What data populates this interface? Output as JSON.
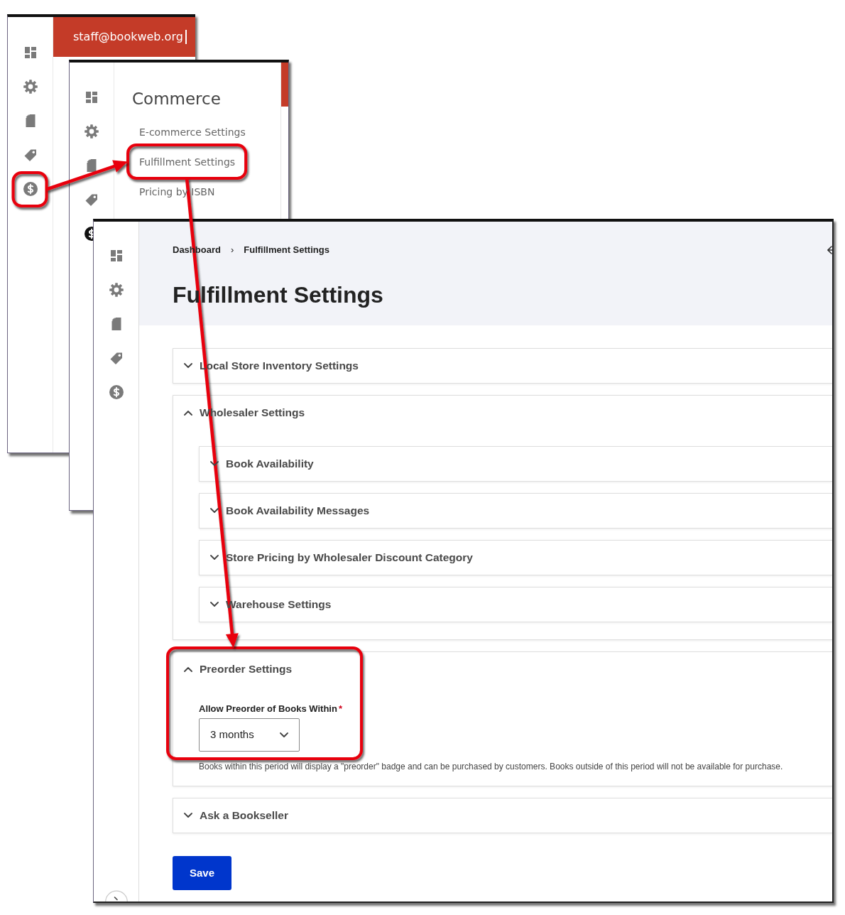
{
  "windows": [
    {
      "kind": "account",
      "account_email": "staff@bookweb.org",
      "sidebar_items": [
        {
          "selected": false,
          "highlighted": false
        },
        {
          "selected": false,
          "highlighted": false
        },
        {
          "selected": false,
          "highlighted": false
        },
        {
          "selected": false,
          "highlighted": false
        },
        {
          "selected": false,
          "highlighted": true
        }
      ]
    },
    {
      "kind": "menu",
      "sidebar_items": [
        {
          "selected": false
        },
        {
          "selected": false
        },
        {
          "selected": false
        },
        {
          "selected": false
        },
        {
          "selected": true
        }
      ],
      "menu": {
        "title": "Commerce",
        "items": [
          {
            "label": "E-commerce Settings",
            "highlighted": false
          },
          {
            "label": "Fulfillment Settings",
            "highlighted": true
          },
          {
            "label": "Pricing by ISBN",
            "highlighted": false
          }
        ]
      }
    },
    {
      "kind": "page",
      "sidebar_items": [
        {
          "selected": false
        },
        {
          "selected": false
        },
        {
          "selected": false
        },
        {
          "selected": false
        },
        {
          "selected": false
        }
      ],
      "breadcrumb": [
        "Dashboard",
        "Fulfillment Settings"
      ],
      "breadcrumb_separator": "›",
      "title": "Fulfillment Settings",
      "sections": [
        {
          "title": "Local Store Inventory Settings",
          "expanded": false,
          "highlighted": false
        },
        {
          "title": "Wholesaler Settings",
          "expanded": true,
          "highlighted": false,
          "children": [
            {
              "title": "Book Availability",
              "expanded": false
            },
            {
              "title": "Book Availability Messages",
              "expanded": false
            },
            {
              "title": "Store Pricing by Wholesaler Discount Category",
              "expanded": false
            },
            {
              "title": "Warehouse Settings",
              "expanded": false
            }
          ]
        },
        {
          "title": "Preorder Settings",
          "expanded": true,
          "highlighted": true,
          "fields": [
            {
              "label": "Allow Preorder of Books Within",
              "required_mark": "*",
              "value": "3 months",
              "help": "Books within this period will display a \"preorder\" badge and can be purchased by customers. Books outside of this period will not be available for purchase."
            }
          ]
        },
        {
          "title": "Ask a Bookseller",
          "expanded": false,
          "highlighted": false
        }
      ],
      "save_button": "Save"
    }
  ]
}
